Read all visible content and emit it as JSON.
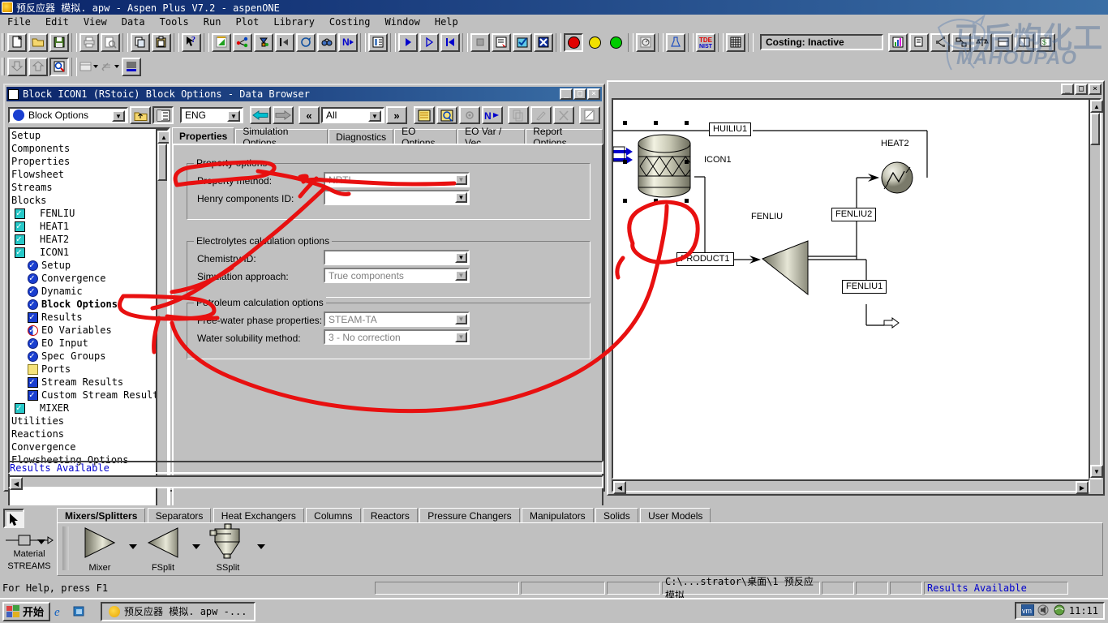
{
  "app": {
    "title": "预反应器 模拟. apw - Aspen Plus V7.2 - aspenONE",
    "icon": "aspen-icon",
    "menus": [
      {
        "label": "File"
      },
      {
        "label": "Edit"
      },
      {
        "label": "View"
      },
      {
        "label": "Data"
      },
      {
        "label": "Tools"
      },
      {
        "label": "Run"
      },
      {
        "label": "Plot"
      },
      {
        "label": "Library"
      },
      {
        "label": "Costing"
      },
      {
        "label": "Window"
      },
      {
        "label": "Help"
      }
    ],
    "costing_status": "Costing: Inactive",
    "watermark_cn": "马后炮化工",
    "watermark_en": "MAHOUPAO"
  },
  "toolbar": {
    "row1": [
      {
        "name": "new-icon",
        "glyph": "□"
      },
      {
        "name": "open-icon",
        "glyph": "📁"
      },
      {
        "name": "save-icon",
        "glyph": "💾"
      },
      {
        "name": "print-icon",
        "glyph": "⎙"
      },
      {
        "name": "print-preview-icon",
        "glyph": "🔍"
      },
      {
        "name": "copy-icon",
        "glyph": "⎘"
      },
      {
        "name": "paste-icon",
        "glyph": "📋"
      },
      {
        "name": "help-pointer-icon",
        "glyph": "?"
      },
      {
        "name": "properties-env-icon",
        "glyph": "◢"
      },
      {
        "name": "simulation-env-icon",
        "glyph": "✶"
      },
      {
        "name": "economics-env-icon",
        "glyph": "⚗"
      },
      {
        "name": "previous-sheet-icon",
        "glyph": "⇤"
      },
      {
        "name": "next-sheet-icon",
        "glyph": "↩"
      },
      {
        "name": "view-results-icon",
        "glyph": "∞"
      },
      {
        "name": "next-input-icon",
        "glyph": "N→"
      },
      {
        "name": "data-browser-icon",
        "glyph": "▦"
      },
      {
        "name": "run-icon",
        "glyph": "▶"
      },
      {
        "name": "step-icon",
        "glyph": "▷"
      },
      {
        "name": "reinitialize-icon",
        "glyph": "⏮"
      },
      {
        "name": "stop-icon",
        "glyph": "■"
      },
      {
        "name": "control-panel-icon",
        "glyph": "☷"
      },
      {
        "name": "check-results-icon",
        "glyph": "☑"
      },
      {
        "name": "reconcile-icon",
        "glyph": "☒"
      },
      {
        "name": "status-red-icon",
        "color": "#e00000"
      },
      {
        "name": "status-yellow-icon",
        "color": "#f0e000"
      },
      {
        "name": "status-green-icon",
        "color": "#00cc00"
      },
      {
        "name": "plot-wizard-icon",
        "glyph": "◴"
      },
      {
        "name": "analysis-icon",
        "glyph": "⚗"
      },
      {
        "name": "nist-tde-icon",
        "glyph": "TDE"
      },
      {
        "name": "grid-icon",
        "glyph": "▦"
      }
    ],
    "row1_after_costing": [
      {
        "name": "costing-chart-icon",
        "glyph": "📊"
      },
      {
        "name": "costing-report-icon",
        "glyph": "☷"
      },
      {
        "name": "costing-link-icon",
        "glyph": "⋖"
      },
      {
        "name": "costing-map-icon",
        "glyph": "⌗"
      },
      {
        "name": "costing-balance-icon",
        "glyph": "⚖"
      },
      {
        "name": "costing-view1-icon",
        "glyph": "▤"
      },
      {
        "name": "costing-view2-icon",
        "glyph": "▥"
      },
      {
        "name": "costing-view3-icon",
        "glyph": "▧"
      }
    ],
    "row2": [
      {
        "name": "import-icon",
        "glyph": "⬇"
      },
      {
        "name": "export-icon",
        "glyph": "⬆"
      },
      {
        "name": "zoom-icon",
        "glyph": "🔎"
      },
      {
        "name": "stream-table-icon",
        "glyph": "▤"
      },
      {
        "name": "annotation-icon",
        "glyph": "✎"
      },
      {
        "name": "display-options-icon",
        "glyph": "▦"
      }
    ]
  },
  "data_browser": {
    "title": "Block ICON1  (RStoic) Block Options - Data Browser",
    "window_buttons": [
      "minimize",
      "maximize",
      "close"
    ],
    "selector_value": "Block Options",
    "units_value": "ENG",
    "filter_value": "All",
    "nav_buttons": [
      {
        "name": "up-one-level-icon",
        "glyph": "⬑"
      },
      {
        "name": "tree-toggle-icon",
        "glyph": "▥"
      },
      {
        "name": "back-icon",
        "glyph": "←"
      },
      {
        "name": "forward-icon",
        "glyph": "→"
      },
      {
        "name": "prev-sheet-icon",
        "glyph": "«"
      },
      {
        "name": "next-sheet-icon",
        "glyph": "»"
      },
      {
        "name": "input-summary-icon",
        "glyph": "▤"
      },
      {
        "name": "find-icon",
        "glyph": "🔍"
      },
      {
        "name": "settings-icon",
        "glyph": "⚙"
      },
      {
        "name": "next-input-icon",
        "glyph": "N→"
      },
      {
        "name": "copy-form-icon",
        "glyph": "⎘"
      },
      {
        "name": "edit-form-icon",
        "glyph": "✎"
      },
      {
        "name": "delete-form-icon",
        "glyph": "✕"
      },
      {
        "name": "report-icon",
        "glyph": "▨"
      }
    ],
    "tree": [
      {
        "label": "Setup",
        "indent": 0,
        "icon": "none"
      },
      {
        "label": "Components",
        "indent": 0,
        "icon": "none"
      },
      {
        "label": "Properties",
        "indent": 0,
        "icon": "none"
      },
      {
        "label": "Flowsheet",
        "indent": 0,
        "icon": "none"
      },
      {
        "label": "Streams",
        "indent": 0,
        "icon": "none"
      },
      {
        "label": "Blocks",
        "indent": 0,
        "icon": "none"
      },
      {
        "label": "FENLIU",
        "indent": 1,
        "icon": "cyan"
      },
      {
        "label": "HEAT1",
        "indent": 1,
        "icon": "cyan"
      },
      {
        "label": "HEAT2",
        "indent": 1,
        "icon": "cyan"
      },
      {
        "label": "ICON1",
        "indent": 1,
        "icon": "cyan"
      },
      {
        "label": "Setup",
        "indent": 2,
        "icon": "circ"
      },
      {
        "label": "Convergence",
        "indent": 2,
        "icon": "circ"
      },
      {
        "label": "Dynamic",
        "indent": 2,
        "icon": "circ"
      },
      {
        "label": "Block Options",
        "indent": 2,
        "icon": "circ",
        "selected": true
      },
      {
        "label": "Results",
        "indent": 2,
        "icon": "blue"
      },
      {
        "label": "EO Variables",
        "indent": 2,
        "icon": "half"
      },
      {
        "label": "EO Input",
        "indent": 2,
        "icon": "circ"
      },
      {
        "label": "Spec Groups",
        "indent": 2,
        "icon": "circ"
      },
      {
        "label": "Ports",
        "indent": 2,
        "icon": "folder"
      },
      {
        "label": "Stream Results",
        "indent": 2,
        "icon": "blue"
      },
      {
        "label": "Custom Stream Results",
        "indent": 2,
        "icon": "blue"
      },
      {
        "label": "MIXER",
        "indent": 1,
        "icon": "cyan"
      },
      {
        "label": "Utilities",
        "indent": 0,
        "icon": "none"
      },
      {
        "label": "Reactions",
        "indent": 0,
        "icon": "none"
      },
      {
        "label": "Convergence",
        "indent": 0,
        "icon": "none"
      },
      {
        "label": "Flowsheeting Options",
        "indent": 0,
        "icon": "none"
      }
    ],
    "tabs": [
      {
        "label": "Properties",
        "active": true
      },
      {
        "label": "Simulation Options",
        "active": false
      },
      {
        "label": "Diagnostics",
        "active": false
      },
      {
        "label": "EO Options",
        "active": false
      },
      {
        "label": "EO Var / Vec",
        "active": false
      },
      {
        "label": "Report Options",
        "active": false
      }
    ],
    "groups": [
      {
        "caption": "Property options",
        "fields": [
          {
            "label": "Property method:",
            "value": "NRTL",
            "dim": true
          },
          {
            "label": "Henry components ID:",
            "value": "",
            "dim": false
          }
        ]
      },
      {
        "caption": "Electrolytes calculation options",
        "fields": [
          {
            "label": "Chemistry ID:",
            "value": "",
            "dim": false
          },
          {
            "label": "Simulation approach:",
            "value": "True components",
            "dim": true
          }
        ]
      },
      {
        "caption": "Petroleum calculation options",
        "fields": [
          {
            "label": "Free-water phase properties:",
            "value": "STEAM-TA",
            "dim": true
          },
          {
            "label": "Water solubility method:",
            "value": "3 - No correction",
            "dim": true
          }
        ]
      }
    ],
    "status_message": "Results Available"
  },
  "flowsheet": {
    "window_buttons": [
      "minimize",
      "maximize",
      "close"
    ],
    "blocks": [
      {
        "name": "ICON1",
        "type": "reactor",
        "label": "ICON1"
      },
      {
        "name": "HEAT2",
        "type": "heater",
        "label": "HEAT2"
      },
      {
        "name": "FENLIU",
        "type": "splitter",
        "label": "FENLIU"
      }
    ],
    "streams": [
      {
        "label": "HUILIU1"
      },
      {
        "label": "PRODUCT1"
      },
      {
        "label": "FENLIU2"
      },
      {
        "label": "FENLIU1"
      }
    ]
  },
  "palette": {
    "pointer_icon": "arrow-pointer-icon",
    "stream_label": "Material",
    "stream_group": "STREAMS",
    "tabs": [
      {
        "label": "Mixers/Splitters",
        "active": true
      },
      {
        "label": "Separators",
        "active": false
      },
      {
        "label": "Heat Exchangers",
        "active": false
      },
      {
        "label": "Columns",
        "active": false
      },
      {
        "label": "Reactors",
        "active": false
      },
      {
        "label": "Pressure Changers",
        "active": false
      },
      {
        "label": "Manipulators",
        "active": false
      },
      {
        "label": "Solids",
        "active": false
      },
      {
        "label": "User Models",
        "active": false
      }
    ],
    "models": [
      {
        "label": "Mixer"
      },
      {
        "label": "FSplit"
      },
      {
        "label": "SSplit"
      }
    ]
  },
  "statusbar": {
    "help_text": "For Help, press F1",
    "path": "C:\\...strator\\桌面\\1 预反应模拟",
    "results": "Results Available"
  },
  "taskbar": {
    "start_label": "开始",
    "quick_launch": [
      {
        "name": "internet-explorer-icon",
        "glyph": "e"
      },
      {
        "name": "show-desktop-icon",
        "glyph": "⧉"
      }
    ],
    "task_label": "预反应器 模拟. apw -...",
    "tray": [
      {
        "name": "vm-tray-icon",
        "glyph": "vm"
      },
      {
        "name": "volume-tray-icon",
        "glyph": "🔊"
      },
      {
        "name": "network-tray-icon",
        "glyph": "⚇"
      }
    ],
    "clock": "11:11"
  }
}
